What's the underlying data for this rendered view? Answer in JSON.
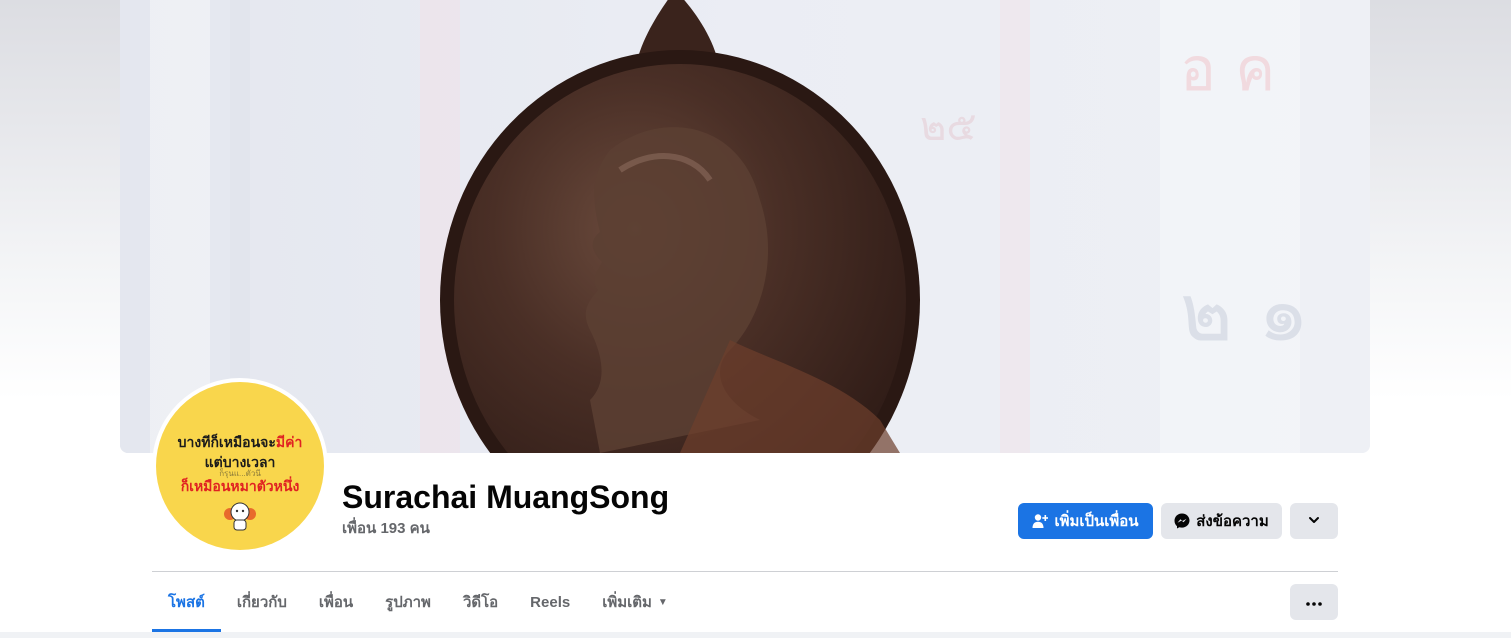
{
  "profile": {
    "name": "Surachai MuangSong",
    "friends_count": "เพื่อน 193 คน"
  },
  "avatar": {
    "line1_prefix": "บางทีก็เหมือนจะ",
    "line1_accent": "มีค่า",
    "line2": "แต่บางเวลา",
    "line2_small": "ก็รุนแ...ตัวนี",
    "line3": "ก็เหมือนหมาตัวหนึ่ง"
  },
  "actions": {
    "add_friend": "เพิ่มเป็นเพื่อน",
    "message": "ส่งข้อความ"
  },
  "tabs": [
    {
      "label": "โพสต์",
      "active": true
    },
    {
      "label": "เกี่ยวกับ"
    },
    {
      "label": "เพื่อน"
    },
    {
      "label": "รูปภาพ"
    },
    {
      "label": "วิดีโอ"
    },
    {
      "label": "Reels"
    },
    {
      "label": "เพิ่มเติม"
    }
  ],
  "icons": {
    "add_friend": "person-plus-icon",
    "message": "messenger-icon",
    "expand": "chevron-down-icon",
    "more": "more-horizontal-icon",
    "more_tab": "caret-down-icon"
  },
  "colors": {
    "primary": "#1b74e4",
    "secondary_button": "#e4e6eb",
    "text_primary": "#050505",
    "text_secondary": "#65676b",
    "avatar_bg": "#f9d64c"
  }
}
